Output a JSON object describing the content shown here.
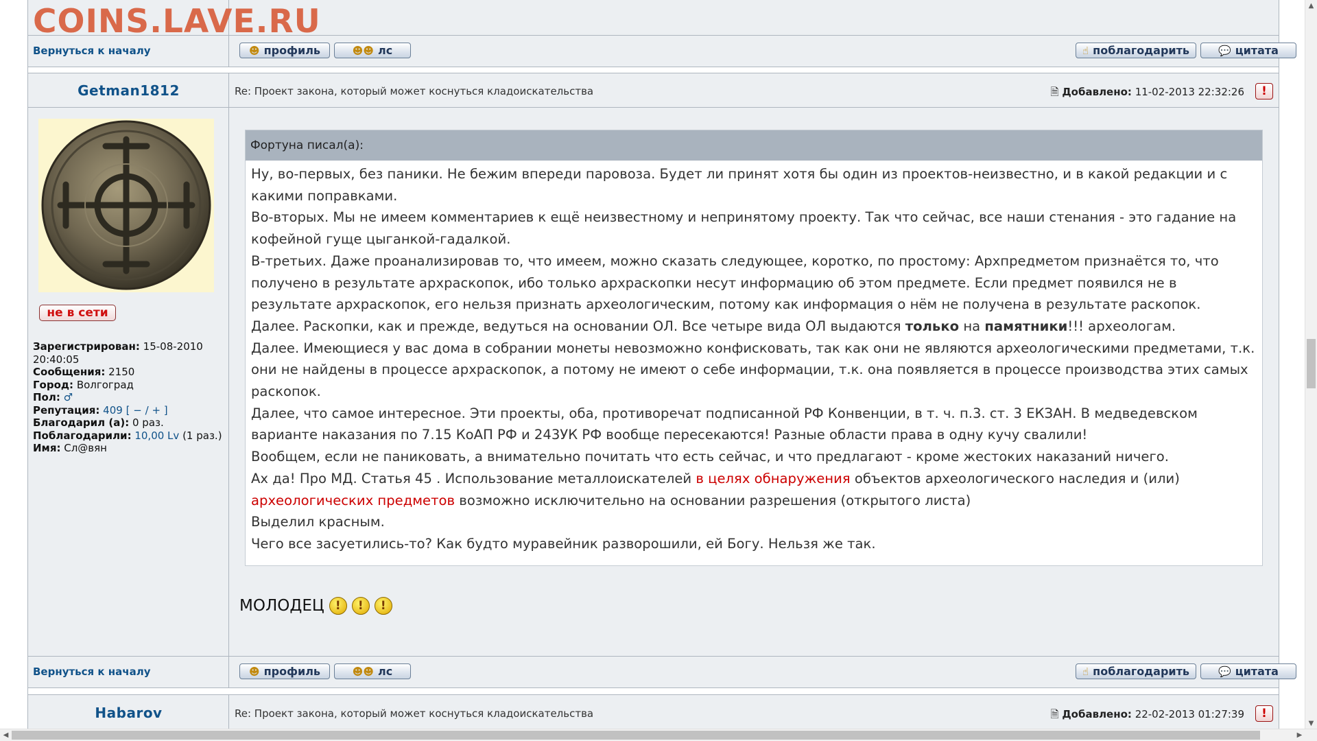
{
  "watermark": "COINS.LAVE.RU",
  "nav": {
    "back_to_top": "Вернуться к началу"
  },
  "buttons": {
    "profile": "профиль",
    "pm": "лс",
    "thank": "поблагодарить",
    "quote": "цитата",
    "report": "!"
  },
  "post1": {
    "author": "Getman1812",
    "subject": "Re: Проект закона, который может коснуться кладоискательства",
    "added_label": "Добавлено:",
    "added_date": "11-02-2013 22:32:26",
    "status": "не в сети",
    "profile": {
      "registered_label": "Зарегистрирован:",
      "registered_value": "15-08-2010 20:40:05",
      "messages_label": "Сообщения:",
      "messages_value": "2150",
      "city_label": "Город:",
      "city_value": "Волгоград",
      "gender_label": "Пол:",
      "reputation_label": "Репутация:",
      "reputation_value": "409",
      "rep_open": "[",
      "rep_minus": "−",
      "rep_sep": "/",
      "rep_plus": "+",
      "rep_close": "]",
      "thanked_label": "Благодарил (а):",
      "thanked_value": "0 раз.",
      "was_thanked_label": "Поблагодарили:",
      "was_thanked_value": "10,00 Lv",
      "was_thanked_count": "(1 раз.)",
      "name_label": "Имя:",
      "name_value": "Сл@вян"
    },
    "quote": {
      "header": "Фортуна писал(а):",
      "p1": "Ну, во-первых, без паники. Не бежим впереди паровоза. Будет ли принят хотя бы один из проектов-неизвестно, и в какой редакции и с какими поправками.",
      "p2": "Во-вторых. Мы не имеем комментариев к ещё неизвестному и непринятому проекту. Так что сейчас, все наши стенания - это гадание на кофейной гуще цыганкой-гадалкой.",
      "p3": "В-третьих. Даже проанализировав то, что имеем, можно сказать следующее, коротко, по простому: Архпредметом признаётся то, что получено в результате архраскопок, ибо только архраскопки несут информацию об этом предмете. Если предмет появился не в результате архраскопок, его нельзя признать археологическим, потому как информация о нём не получена в результате раскопок.",
      "p4_a": "Далее. Раскопки, как и прежде, ведуться на основании ОЛ. Все четыре вида ОЛ выдаются ",
      "p4_b": "только",
      "p4_c": " на ",
      "p4_d": "памятники",
      "p4_e": "!!! археологам.",
      "p5": "Далее. Имеющиеся у вас дома в собрании монеты невозможно конфисковать, так как они не являются археологическими предметами, т.к. они не найдены в процессе архраскопок, а потому не имеют о себе информации, т.к. она появляется в процессе производства этих самых раскопок.",
      "p6": "Далее, что самое интересное. Эти проекты, оба, противоречат подписанной РФ Конвенции, в т. ч. п.3. ст. 3 ЕКЗАН. В медведевском варианте наказания по 7.15 КоАП РФ и 243УК РФ вообще пересекаются! Разные области права в одну кучу свалили!",
      "p7": "Вообщем, если не паниковать, а внимательно почитать что есть сейчас, и что предлагают - кроме жестоких наказаний ничего.",
      "p8_a": "Ах да! Про МД. Статья 45 . Использование металлоискателей ",
      "p8_b": "в целях обнаружения",
      "p8_c": " объектов археологического наследия и (или) ",
      "p8_d": "археологических предметов",
      "p8_e": " возможно исключительно на основании разрешения (открытого листа)",
      "p9": "Выделил красным.",
      "p10": "Чего все засуетились-то? Как будто муравейник разворошили, ей Богу. Нельзя же так."
    },
    "reply_text": "МОЛОДЕЦ",
    "smiles": [
      "!",
      "!",
      "!"
    ]
  },
  "post2": {
    "author": "Habarov",
    "subject": "Re: Проект закона, который может коснуться кладоискательства",
    "added_label": "Добавлено:",
    "added_date": "22-02-2013 01:27:39"
  },
  "colors": {
    "link": "#105289",
    "highlight_red": "#cc0000",
    "quote_header_bg": "#a9b3be",
    "panel_bg": "#eceff2",
    "watermark": "#d9694a"
  },
  "icons": {
    "profile": "user-icon",
    "pm": "users-icon",
    "thank": "thumbs-up-icon",
    "quote": "speech-bubble-icon",
    "added": "document-icon",
    "gender": "male-icon"
  }
}
